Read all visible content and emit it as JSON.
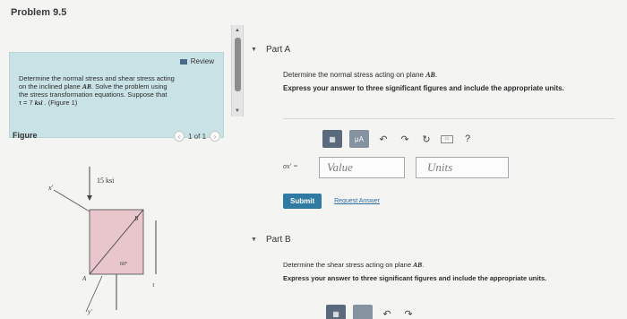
{
  "page": {
    "title": "Problem 9.5"
  },
  "left": {
    "review_label": "Review",
    "problem_line1": "Determine the normal stress and shear stress acting",
    "problem_line2a": "on the inclined plane ",
    "problem_line2b": "AB",
    "problem_line2c": ". Solve the problem using",
    "problem_line3": "the stress transformation equations. Suppose that",
    "problem_line4a": "τ = 7 ",
    "problem_line4b": "ksi",
    "problem_line4c": " . (Figure 1)",
    "figure_label": "Figure",
    "pager_text": "1 of 1",
    "figure": {
      "stress_label": "15 ksi",
      "label_b": "B",
      "label_a": "A",
      "angle_label": "60°",
      "axis_x": "x'",
      "axis_y": "y'",
      "tau": "τ"
    }
  },
  "partA": {
    "title": "Part A",
    "question_a": "Determine the normal stress acting on plane ",
    "question_b": "AB",
    "question_c": ".",
    "instruction": "Express your answer to three significant figures and include the appropriate units.",
    "symbol": "σx' =",
    "value_placeholder": "Value",
    "units_placeholder": "Units",
    "toolbar": {
      "btn2": "μA",
      "help": "?"
    },
    "submit_label": "Submit",
    "request_label": "Request Answer"
  },
  "partB": {
    "title": "Part B",
    "question_a": "Determine the shear stress acting on plane ",
    "question_b": "AB",
    "question_c": ".",
    "instruction": "Express your answer to three significant figures and include the appropriate units."
  },
  "colors": {
    "review_bg": "#c9e2e6",
    "submit_bg": "#2e7aa3",
    "link": "#2e6ea1"
  }
}
